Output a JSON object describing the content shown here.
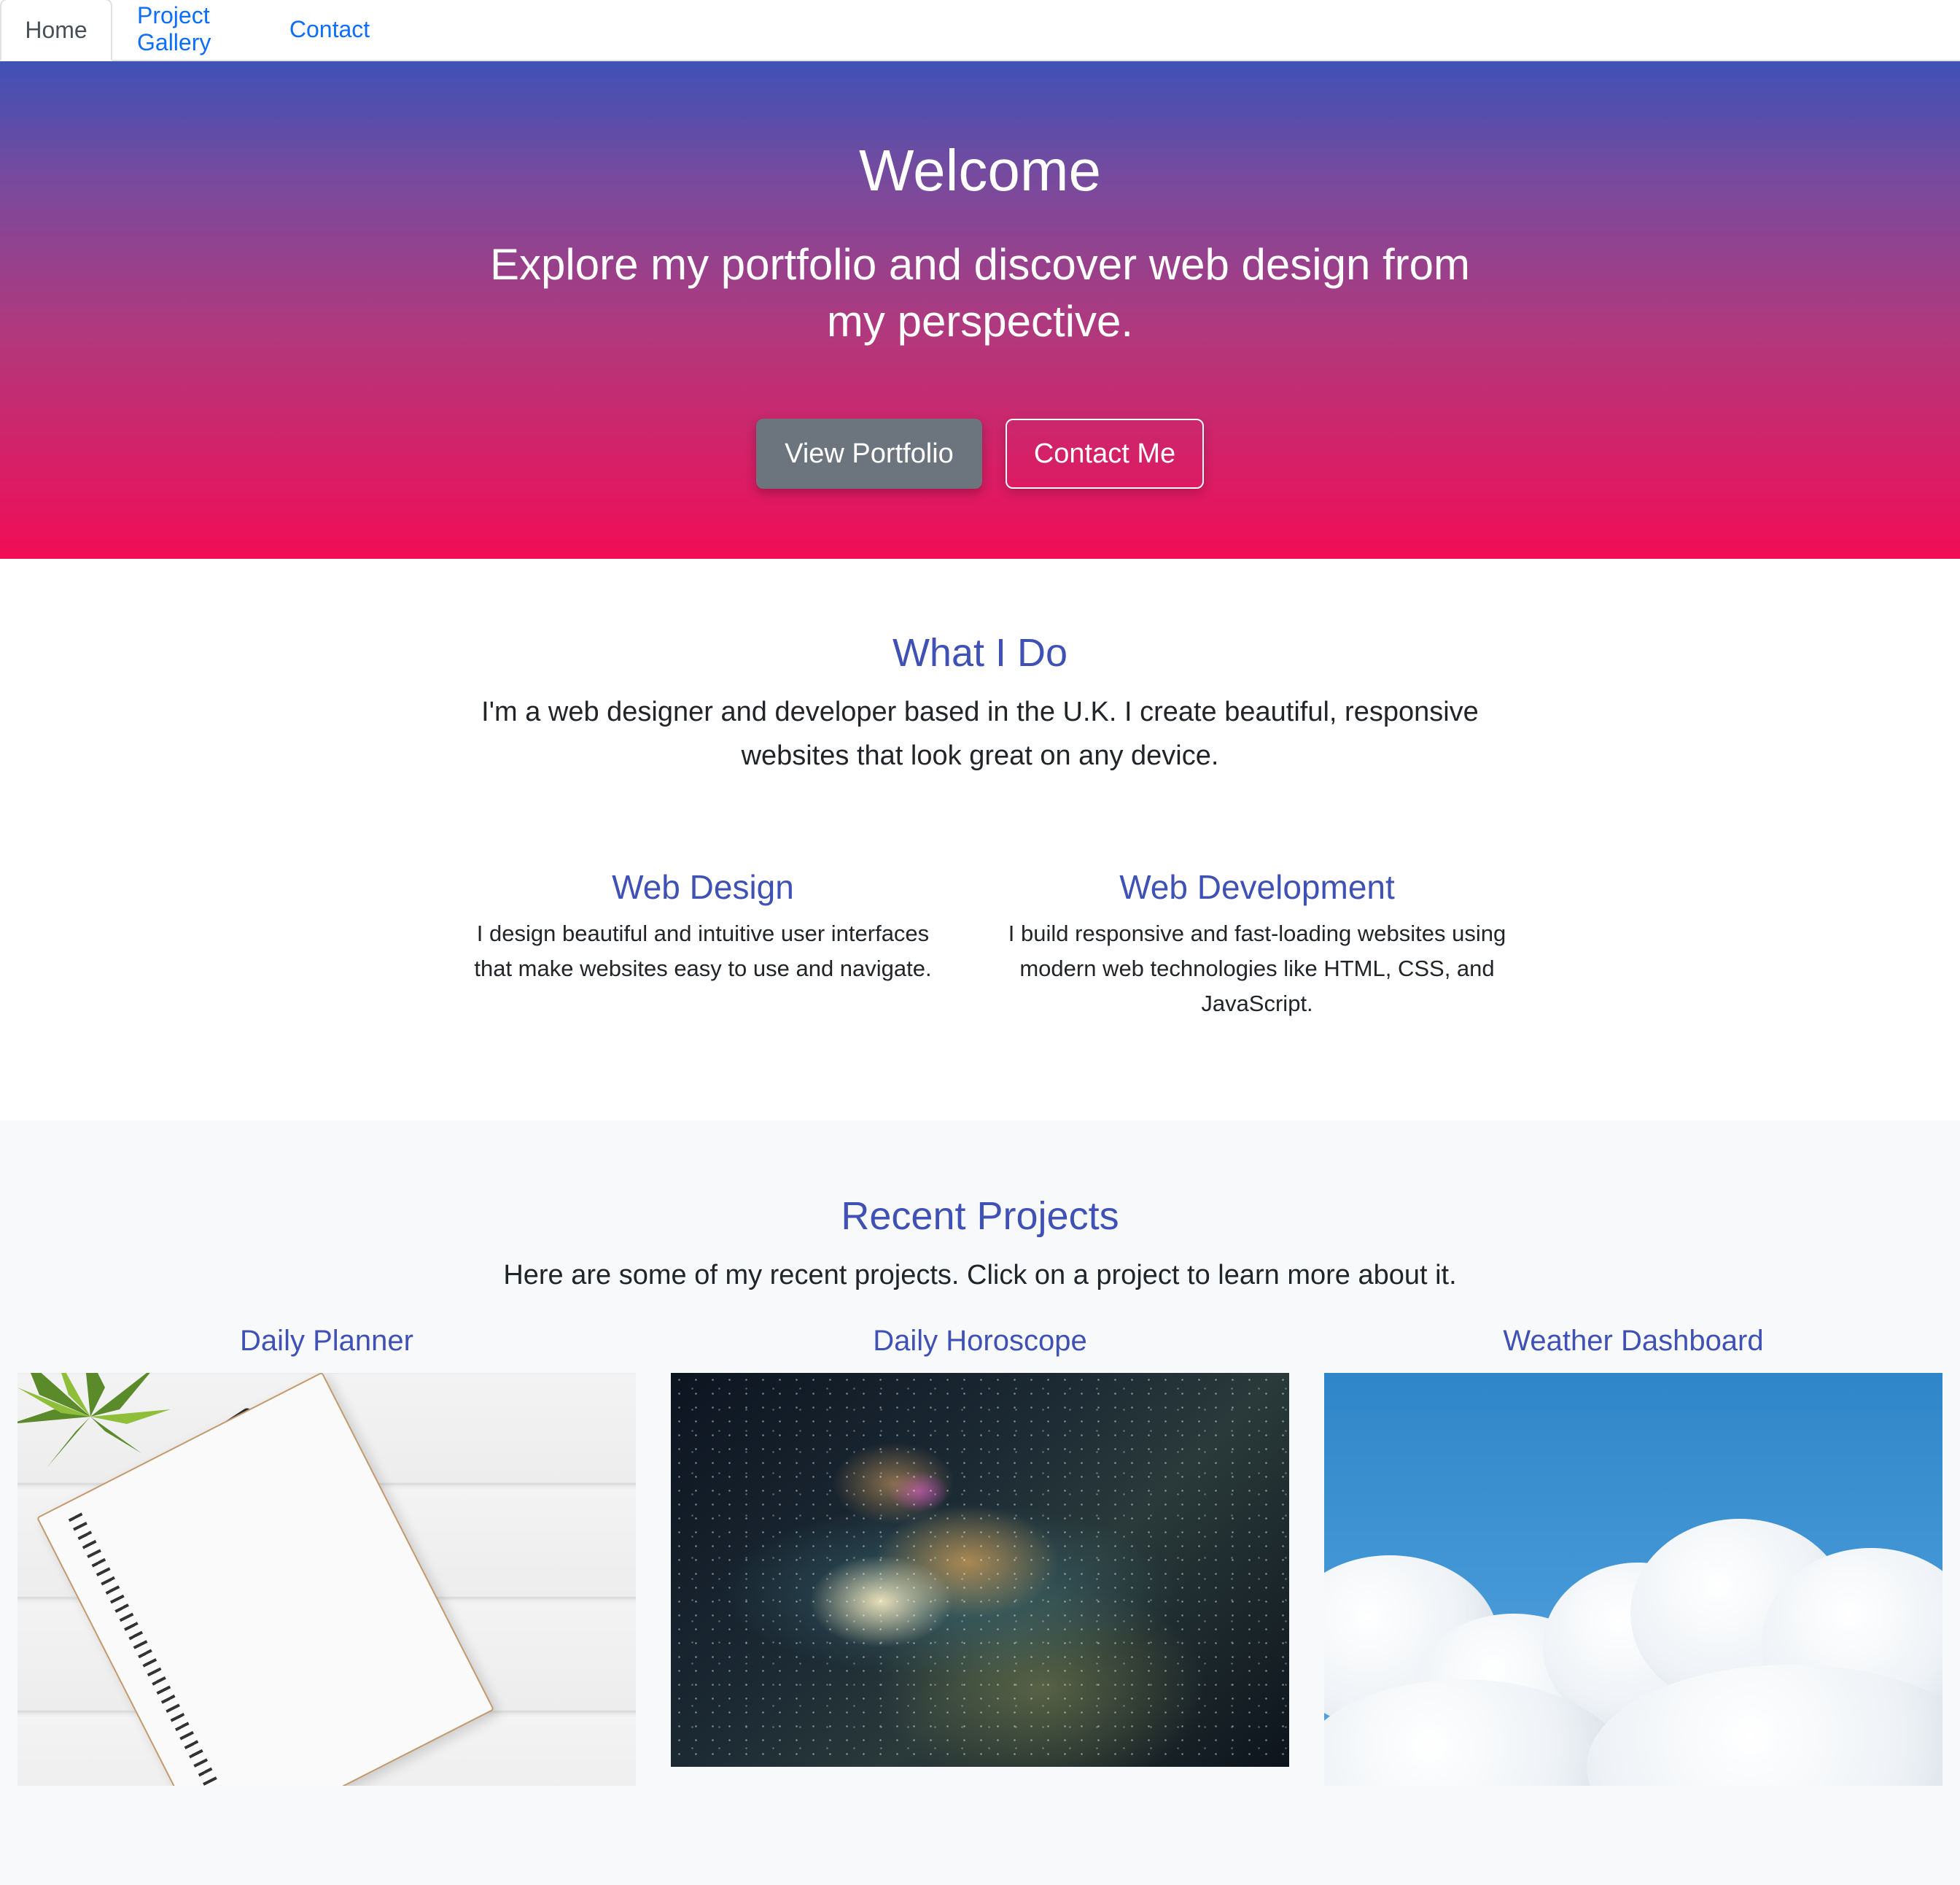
{
  "nav": {
    "tabs": [
      {
        "label": "Home",
        "active": true
      },
      {
        "label": "Project Gallery",
        "active": false
      },
      {
        "label": "Contact",
        "active": false
      }
    ]
  },
  "hero": {
    "title": "Welcome",
    "subtitle": "Explore my portfolio and discover web design from my perspective.",
    "primary_button": "View Portfolio",
    "secondary_button": "Contact Me"
  },
  "about": {
    "title": "What I Do",
    "text": "I'm a web designer and developer based in the U.K. I create beautiful, responsive websites that look great on any device.",
    "services": [
      {
        "title": "Web Design",
        "text": "I design beautiful and intuitive user interfaces that make websites easy to use and navigate."
      },
      {
        "title": "Web Development",
        "text": "I build responsive and fast-loading websites using modern web technologies like HTML, CSS, and JavaScript."
      }
    ]
  },
  "projects": {
    "title": "Recent Projects",
    "text": "Here are some of my recent projects. Click on a project to learn more about it.",
    "items": [
      {
        "title": "Daily Planner",
        "image": "notebook-photo"
      },
      {
        "title": "Daily Horoscope",
        "image": "milky-way-photo"
      },
      {
        "title": "Weather Dashboard",
        "image": "clouds-photo"
      }
    ]
  },
  "colors": {
    "accent": "#3f51b5",
    "link": "#0d6efd",
    "hero_top": "#3f51b5",
    "hero_bottom": "#f10d56",
    "button_primary": "#6c757d"
  }
}
